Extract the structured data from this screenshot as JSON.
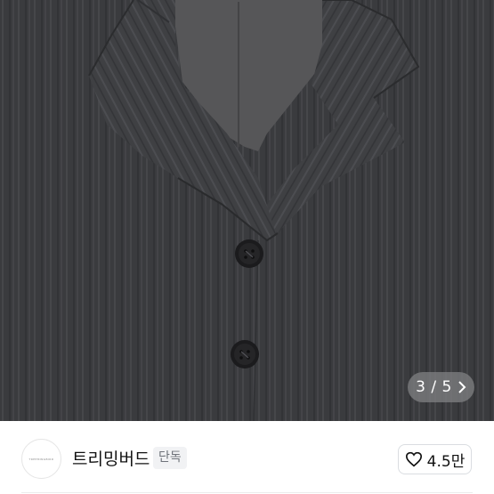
{
  "product_image": {
    "alt": "charcoal herringbone jacket close-up",
    "pager_text": "3 / 5",
    "chevron_icon": "chevron-right-icon"
  },
  "shop": {
    "logo_text": "TREEMINGBIRD",
    "name": "트리밍버드",
    "badge": "단독",
    "like_count": "4.5만",
    "heart_icon": "heart-outline-icon"
  },
  "colors": {
    "fabric": "#3b3c3f",
    "lining": "#565658",
    "pager_bg": "#7d7d80",
    "badge_bg": "#f1f2f4"
  }
}
